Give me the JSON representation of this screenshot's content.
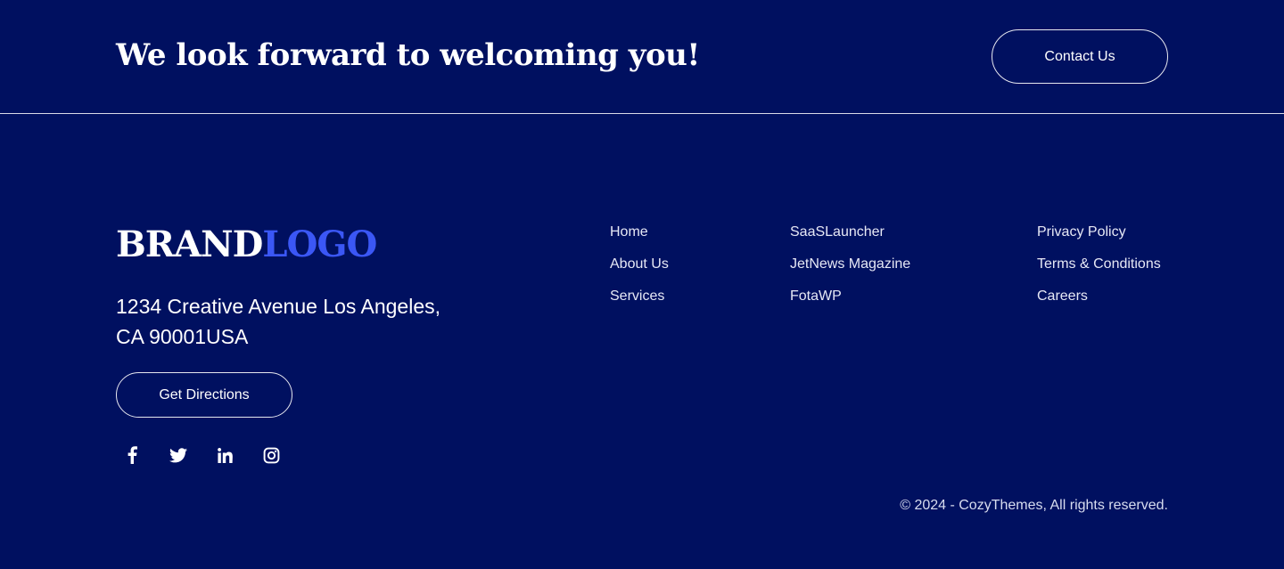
{
  "colors": {
    "background": "#001060",
    "text": "#ffffff",
    "logo_accent": "#3b57f5"
  },
  "cta": {
    "heading": "We look forward to welcoming you!",
    "button_label": "Contact Us"
  },
  "footer": {
    "logo": {
      "part1": "BRAND",
      "part2": "LOGO"
    },
    "address_line1": "1234 Creative Avenue Los Angeles,",
    "address_line2": "CA 90001USA",
    "directions_label": "Get Directions",
    "socials": [
      {
        "icon": "facebook-icon"
      },
      {
        "icon": "twitter-icon"
      },
      {
        "icon": "linkedin-icon"
      },
      {
        "icon": "instagram-icon"
      }
    ],
    "nav_columns": [
      {
        "links": [
          "Home",
          "About Us",
          "Services"
        ]
      },
      {
        "links": [
          "SaaSLauncher",
          "JetNews Magazine",
          "FotaWP"
        ]
      },
      {
        "links": [
          "Privacy Policy",
          "Terms & Conditions",
          "Careers"
        ]
      }
    ],
    "copyright": "© 2024 - CozyThemes, All rights reserved."
  }
}
